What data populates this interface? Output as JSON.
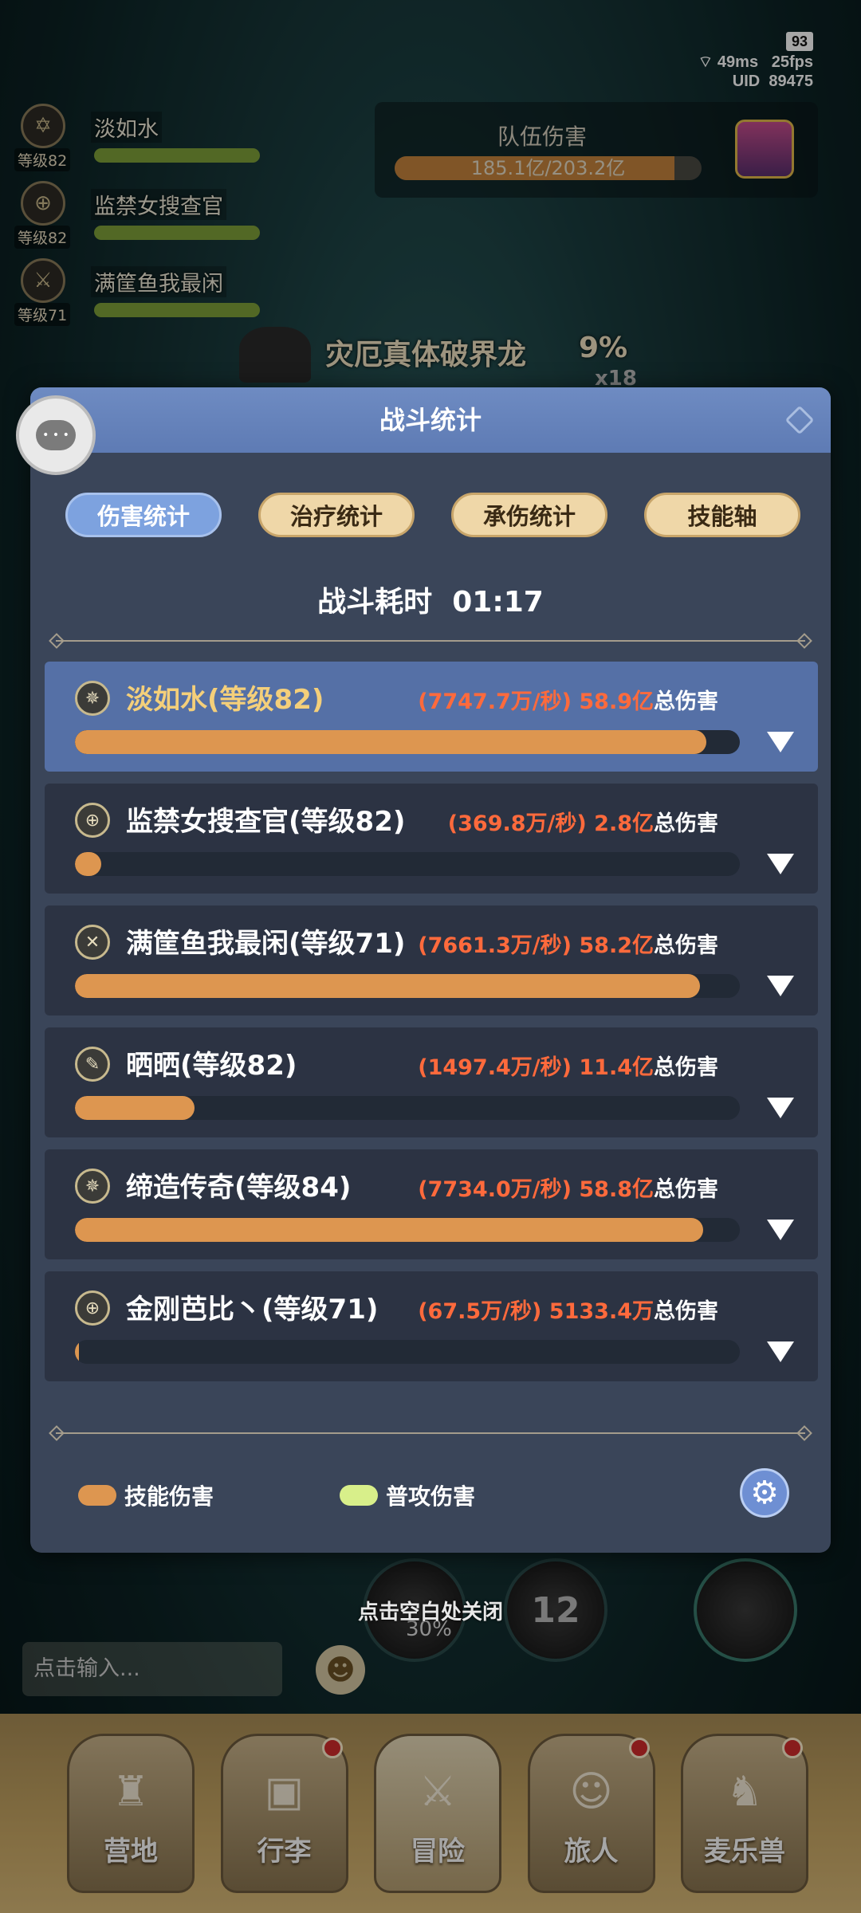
{
  "status": {
    "battery": "93",
    "ping": "49ms",
    "fps": "25fps",
    "uid_label": "UID",
    "uid": "89475"
  },
  "party": [
    {
      "level": "等级82",
      "name": "淡如水"
    },
    {
      "level": "等级82",
      "name": "监禁女搜查官"
    },
    {
      "level": "等级71",
      "name": "满筐鱼我最闲"
    }
  ],
  "team_damage": {
    "title": "队伍伤害",
    "value": "185.1亿/203.2亿",
    "progress": 0.911
  },
  "boss": {
    "name": "灾厄真体破界龙",
    "percent": "9%",
    "multiplier": "x18"
  },
  "modal": {
    "title": "战斗统计",
    "tabs": [
      "伤害统计",
      "治疗统计",
      "承伤统计",
      "技能轴"
    ],
    "elapsed_label": "战斗耗时",
    "elapsed_time": "01:17",
    "players": [
      {
        "name": "淡如水(等级82)",
        "dps": "(7747.7万/秒)",
        "total": "58.9亿",
        "total_label": "总伤害",
        "skill_ratio": 0.95,
        "icon": "compass-star-icon"
      },
      {
        "name": "监禁女搜查官(等级82)",
        "dps": "(369.8万/秒)",
        "total": "2.8亿",
        "total_label": "总伤害",
        "skill_ratio": 0.04,
        "icon": "cross-target-icon"
      },
      {
        "name": "满筐鱼我最闲(等级71)",
        "dps": "(7661.3万/秒)",
        "total": "58.2亿",
        "total_label": "总伤害",
        "skill_ratio": 0.94,
        "icon": "crossed-swords-icon"
      },
      {
        "name": "晒晒(等级82)",
        "dps": "(1497.4万/秒)",
        "total": "11.4亿",
        "total_label": "总伤害",
        "skill_ratio": 0.18,
        "icon": "wand-icon"
      },
      {
        "name": "缔造传奇(等级84)",
        "dps": "(7734.0万/秒)",
        "total": "58.8亿",
        "total_label": "总伤害",
        "skill_ratio": 0.945,
        "icon": "compass-star-icon"
      },
      {
        "name": "金刚芭比丶(等级71)",
        "dps": "(67.5万/秒)",
        "total": "5133.4万",
        "total_label": "总伤害",
        "skill_ratio": 0.006,
        "icon": "cross-target-icon"
      }
    ],
    "legend": [
      {
        "label": "技能伤害",
        "color": "#dd9650"
      },
      {
        "label": "普攻伤害",
        "color": "#d8ef8a"
      }
    ]
  },
  "close_hint": "点击空白处关闭",
  "skills": [
    {
      "text": "30%"
    },
    {
      "text": "12"
    }
  ],
  "chat": {
    "placeholder": "点击输入..."
  },
  "nav": [
    {
      "label": "营地",
      "badge": false
    },
    {
      "label": "行李",
      "badge": true
    },
    {
      "label": "冒险",
      "badge": false,
      "active": true
    },
    {
      "label": "旅人",
      "badge": true
    },
    {
      "label": "麦乐兽",
      "badge": true
    }
  ],
  "colors": {
    "accent": "#5e7bb4",
    "skill_damage": "#dd9650",
    "normal_damage": "#d8ef8a",
    "damage_text": "#ff6a3c"
  }
}
